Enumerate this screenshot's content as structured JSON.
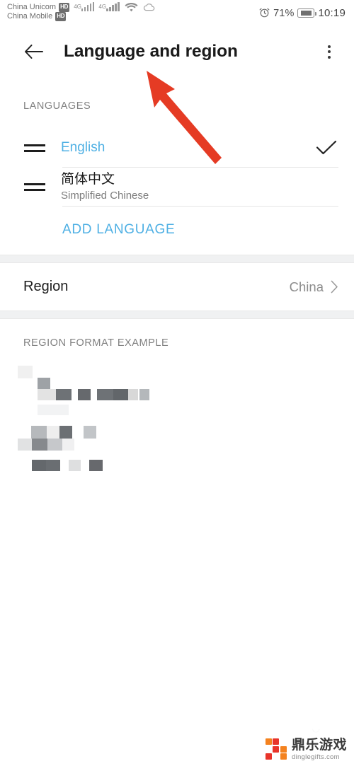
{
  "status_bar": {
    "carrier_primary": "China Unicom",
    "carrier_primary_badge": "HD",
    "carrier_secondary": "China Mobile",
    "carrier_secondary_badge": "HD",
    "network_primary": "4G",
    "network_secondary": "4G",
    "icons": [
      "wifi-icon",
      "cloud-icon",
      "alarm-icon",
      "battery-icon"
    ],
    "battery_percent": "71%",
    "clock": "10:19"
  },
  "app_bar": {
    "back_icon": "arrow-left-icon",
    "title": "Language and region",
    "overflow_icon": "more-vertical-icon"
  },
  "languages": {
    "header": "LANGUAGES",
    "items": [
      {
        "primary": "English",
        "secondary": "",
        "selected": true,
        "handle_icon": "drag-handle-icon",
        "check_icon": "check-icon"
      },
      {
        "primary": "简体中文",
        "secondary": "Simplified Chinese",
        "selected": false,
        "handle_icon": "drag-handle-icon",
        "check_icon": ""
      }
    ],
    "add_language_label": "ADD LANGUAGE"
  },
  "region": {
    "label": "Region",
    "value": "China",
    "chevron_icon": "chevron-right-icon"
  },
  "region_format": {
    "header": "REGION FORMAT EXAMPLE",
    "content_state": "censored"
  },
  "watermark": {
    "brand_cn": "鼎乐游戏",
    "url": "dinglegifts.com",
    "logo_icon": "dinglegifts-logo-icon"
  },
  "annotation": {
    "arrow_icon": "red-arrow-icon",
    "color": "#e53b24",
    "points_to": "Language and region"
  },
  "colors": {
    "accent_blue": "#4fb0e4",
    "text_primary": "#1d1d1d",
    "text_secondary": "#7d7d7d",
    "section_header": "#808080",
    "divider": "#e6e6e6",
    "band": "#f0f1f2",
    "annotation_red": "#e53b24"
  }
}
